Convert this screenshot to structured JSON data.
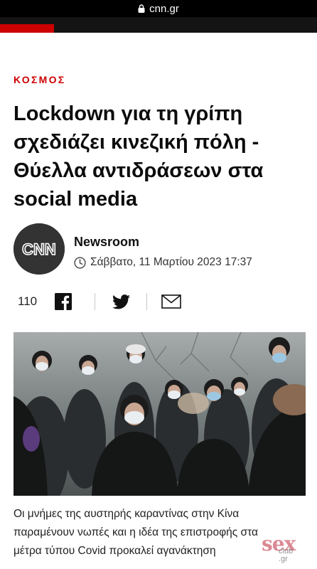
{
  "browser": {
    "domain": "cnn.gr"
  },
  "article": {
    "section": "ΚΟΣΜΟΣ",
    "headline_lines": [
      "Lockdown για τη γρίπη",
      "σχεδιάζει κινεζική πόλη -",
      "Θύελλα αντιδράσεων στα",
      "social media"
    ],
    "author": "Newsroom",
    "date": "Σάββατο, 11 Μαρτίου 2023 17:37",
    "share_count": "110",
    "caption_lines": [
      "Οι μνήμες της αυστηρής καραντίνας στην Κίνα",
      "παραμένουν νωπές και η ιδέα της επιστροφής στα",
      "μέτρα τύπου Covid προκαλεί αγανάκτηση"
    ]
  },
  "logo": {
    "text": "CNN"
  },
  "watermark": {
    "text": "sex",
    "sub1": "club",
    "sub2": ".gr"
  },
  "icons": {
    "lock": "lock-icon",
    "clock": "clock-icon",
    "facebook": "facebook-icon",
    "twitter": "twitter-icon",
    "email": "email-icon"
  },
  "colors": {
    "accent": "#cc0000",
    "topbar": "#000000"
  }
}
